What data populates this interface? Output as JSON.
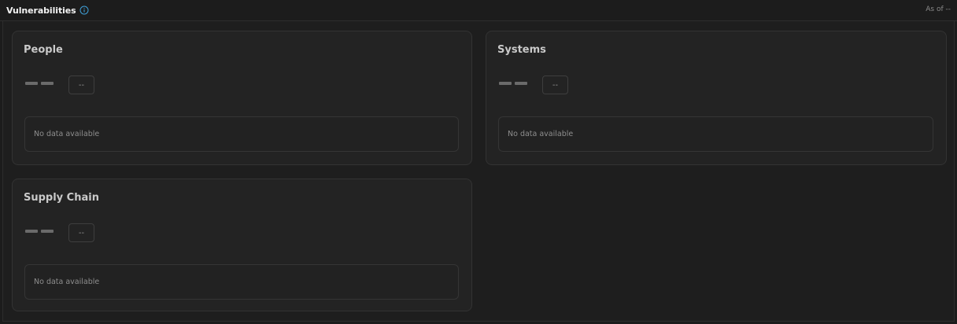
{
  "header": {
    "title": "Vulnerabilities",
    "as_of": "As of --"
  },
  "cards": {
    "people": {
      "title": "People",
      "change": "--",
      "empty_message": "No data available"
    },
    "systems": {
      "title": "Systems",
      "change": "--",
      "empty_message": "No data available"
    },
    "supply_chain": {
      "title": "Supply Chain",
      "change": "--",
      "empty_message": "No data available"
    }
  },
  "icons": {
    "info": "info-circle-icon"
  },
  "colors": {
    "accent_info": "#3fa0d8",
    "card_bg": "#232323",
    "page_bg": "#1c1c1c"
  }
}
